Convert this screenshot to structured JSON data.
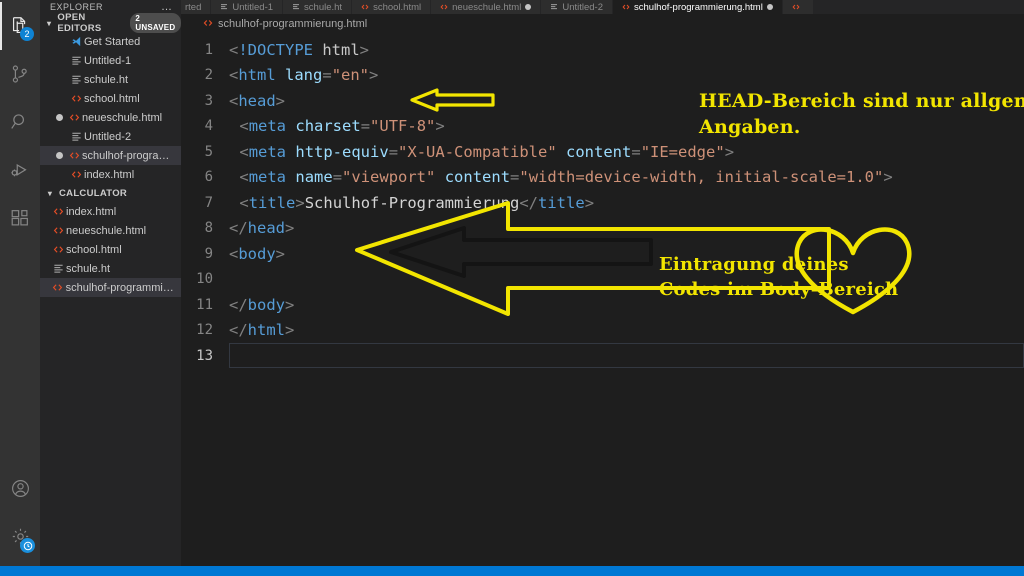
{
  "activitybar": {
    "items": [
      {
        "name": "explorer",
        "icon": "files-icon",
        "badge": "2",
        "active": true
      },
      {
        "name": "source-control",
        "icon": "source-control-icon",
        "badge": "",
        "active": false
      },
      {
        "name": "search",
        "icon": "search-icon",
        "badge": "",
        "active": false
      },
      {
        "name": "run-and-debug",
        "icon": "run-debug-icon",
        "badge": "",
        "active": false
      },
      {
        "name": "extensions",
        "icon": "extensions-icon",
        "badge": "",
        "active": false
      }
    ],
    "bottom": [
      {
        "name": "accounts",
        "icon": "account-icon"
      },
      {
        "name": "manage",
        "icon": "gear-icon",
        "badge_icon": "clock-icon"
      }
    ]
  },
  "sidebar": {
    "title": "EXPLORER",
    "more_actions": "…",
    "sections": [
      {
        "label": "OPEN EDITORS",
        "badge": "2 UNSAVED",
        "expanded": true,
        "items": [
          {
            "label": "Get Started",
            "icon": "vscode-icon",
            "dirty": false,
            "selected": false,
            "indent": 2
          },
          {
            "label": "Untitled-1",
            "icon": "text-icon",
            "dirty": false,
            "selected": false,
            "indent": 2
          },
          {
            "label": "schule.ht",
            "icon": "text-icon",
            "dirty": false,
            "selected": false,
            "indent": 2
          },
          {
            "label": "school.html",
            "icon": "html-icon",
            "dirty": false,
            "selected": false,
            "indent": 2
          },
          {
            "label": "neueschule.html",
            "icon": "html-icon",
            "dirty": true,
            "selected": false,
            "indent": 1
          },
          {
            "label": "Untitled-2",
            "icon": "text-icon",
            "dirty": false,
            "selected": false,
            "indent": 2
          },
          {
            "label": "schulhof-progra…",
            "icon": "html-icon",
            "dirty": true,
            "selected": true,
            "indent": 1
          },
          {
            "label": "index.html",
            "icon": "html-icon",
            "dirty": false,
            "selected": false,
            "indent": 2
          }
        ]
      },
      {
        "label": "CALCULATOR",
        "badge": "",
        "expanded": true,
        "items": [
          {
            "label": "index.html",
            "icon": "html-icon",
            "dirty": false,
            "selected": false,
            "indent": 0
          },
          {
            "label": "neueschule.html",
            "icon": "html-icon",
            "dirty": false,
            "selected": false,
            "indent": 0
          },
          {
            "label": "school.html",
            "icon": "html-icon",
            "dirty": false,
            "selected": false,
            "indent": 0
          },
          {
            "label": "schule.ht",
            "icon": "text-icon",
            "dirty": false,
            "selected": false,
            "indent": 0
          },
          {
            "label": "schulhof-programmie…",
            "icon": "html-icon",
            "dirty": false,
            "selected": true,
            "indent": 0
          }
        ]
      }
    ]
  },
  "editor": {
    "tabs": [
      {
        "label": "rted",
        "icon": "vscode-icon",
        "dirty": false,
        "active": false,
        "clipped": true
      },
      {
        "label": "Untitled-1",
        "icon": "text-icon",
        "dirty": false,
        "active": false
      },
      {
        "label": "schule.ht",
        "icon": "text-icon",
        "dirty": false,
        "active": false
      },
      {
        "label": "school.html",
        "icon": "html-icon",
        "dirty": false,
        "active": false
      },
      {
        "label": "neueschule.html",
        "icon": "html-icon",
        "dirty": true,
        "active": false
      },
      {
        "label": "Untitled-2",
        "icon": "text-icon",
        "dirty": false,
        "active": false
      },
      {
        "label": "schulhof-programmierung.html",
        "icon": "html-icon",
        "dirty": true,
        "active": true
      },
      {
        "label": "",
        "icon": "html-icon",
        "dirty": false,
        "active": false,
        "clipped": true
      }
    ],
    "breadcrumb": {
      "icon": "html-icon",
      "path": "schulhof-programmierung.html"
    },
    "cursor_line": 13,
    "lines": [
      {
        "n": 1,
        "indent": 0,
        "tokens": [
          {
            "t": "<",
            "c": "t-punc"
          },
          {
            "t": "!DOCTYPE",
            "c": "t-doctype"
          },
          {
            "t": " ",
            "c": "t-txt"
          },
          {
            "t": "html",
            "c": "t-doctype-k"
          },
          {
            "t": ">",
            "c": "t-punc"
          }
        ]
      },
      {
        "n": 2,
        "indent": 0,
        "tokens": [
          {
            "t": "<",
            "c": "t-punc"
          },
          {
            "t": "html",
            "c": "t-tag"
          },
          {
            "t": " ",
            "c": "t-txt"
          },
          {
            "t": "lang",
            "c": "t-attr"
          },
          {
            "t": "=",
            "c": "t-punc"
          },
          {
            "t": "\"en\"",
            "c": "t-str"
          },
          {
            "t": ">",
            "c": "t-punc"
          }
        ]
      },
      {
        "n": 3,
        "indent": 0,
        "tokens": [
          {
            "t": "<",
            "c": "t-punc"
          },
          {
            "t": "head",
            "c": "t-tag"
          },
          {
            "t": ">",
            "c": "t-punc"
          }
        ]
      },
      {
        "n": 4,
        "indent": 1,
        "tokens": [
          {
            "t": "<",
            "c": "t-punc"
          },
          {
            "t": "meta",
            "c": "t-tag"
          },
          {
            "t": " ",
            "c": "t-txt"
          },
          {
            "t": "charset",
            "c": "t-attr"
          },
          {
            "t": "=",
            "c": "t-punc"
          },
          {
            "t": "\"UTF-8\"",
            "c": "t-str"
          },
          {
            "t": ">",
            "c": "t-punc"
          }
        ]
      },
      {
        "n": 5,
        "indent": 1,
        "tokens": [
          {
            "t": "<",
            "c": "t-punc"
          },
          {
            "t": "meta",
            "c": "t-tag"
          },
          {
            "t": " ",
            "c": "t-txt"
          },
          {
            "t": "http-equiv",
            "c": "t-attr"
          },
          {
            "t": "=",
            "c": "t-punc"
          },
          {
            "t": "\"X-UA-Compatible\"",
            "c": "t-str"
          },
          {
            "t": " ",
            "c": "t-txt"
          },
          {
            "t": "content",
            "c": "t-attr"
          },
          {
            "t": "=",
            "c": "t-punc"
          },
          {
            "t": "\"IE=edge\"",
            "c": "t-str"
          },
          {
            "t": ">",
            "c": "t-punc"
          }
        ]
      },
      {
        "n": 6,
        "indent": 1,
        "tokens": [
          {
            "t": "<",
            "c": "t-punc"
          },
          {
            "t": "meta",
            "c": "t-tag"
          },
          {
            "t": " ",
            "c": "t-txt"
          },
          {
            "t": "name",
            "c": "t-attr"
          },
          {
            "t": "=",
            "c": "t-punc"
          },
          {
            "t": "\"viewport\"",
            "c": "t-str"
          },
          {
            "t": " ",
            "c": "t-txt"
          },
          {
            "t": "content",
            "c": "t-attr"
          },
          {
            "t": "=",
            "c": "t-punc"
          },
          {
            "t": "\"width=device-width, initial-scale=1.0\"",
            "c": "t-str"
          },
          {
            "t": ">",
            "c": "t-punc"
          }
        ]
      },
      {
        "n": 7,
        "indent": 1,
        "tokens": [
          {
            "t": "<",
            "c": "t-punc"
          },
          {
            "t": "title",
            "c": "t-tag"
          },
          {
            "t": ">",
            "c": "t-punc"
          },
          {
            "t": "Schulhof-Programmierung",
            "c": "t-txt"
          },
          {
            "t": "</",
            "c": "t-punc"
          },
          {
            "t": "title",
            "c": "t-tag"
          },
          {
            "t": ">",
            "c": "t-punc"
          }
        ]
      },
      {
        "n": 8,
        "indent": 0,
        "tokens": [
          {
            "t": "</",
            "c": "t-punc"
          },
          {
            "t": "head",
            "c": "t-tag"
          },
          {
            "t": ">",
            "c": "t-punc"
          }
        ]
      },
      {
        "n": 9,
        "indent": 0,
        "tokens": [
          {
            "t": "<",
            "c": "t-punc"
          },
          {
            "t": "body",
            "c": "t-tag"
          },
          {
            "t": ">",
            "c": "t-punc"
          }
        ]
      },
      {
        "n": 10,
        "indent": 0,
        "tokens": []
      },
      {
        "n": 11,
        "indent": 0,
        "tokens": [
          {
            "t": "</",
            "c": "t-punc"
          },
          {
            "t": "body",
            "c": "t-tag"
          },
          {
            "t": ">",
            "c": "t-punc"
          }
        ]
      },
      {
        "n": 12,
        "indent": 0,
        "tokens": [
          {
            "t": "</",
            "c": "t-punc"
          },
          {
            "t": "html",
            "c": "t-tag"
          },
          {
            "t": ">",
            "c": "t-punc"
          }
        ]
      },
      {
        "n": 13,
        "indent": 0,
        "tokens": []
      }
    ]
  },
  "annotations": {
    "color": "#f2e500",
    "head_note": "HEAD-Bereich sind nur allgemeine\nAngaben.",
    "body_note": "Eintragung deines\nCodes im Body-Bereich",
    "shapes": [
      {
        "name": "small-left-arrow"
      },
      {
        "name": "large-left-arrow"
      },
      {
        "name": "inner-black-arrow"
      },
      {
        "name": "heart-outline"
      }
    ]
  },
  "statusbar": {
    "color": "#0078d4"
  }
}
